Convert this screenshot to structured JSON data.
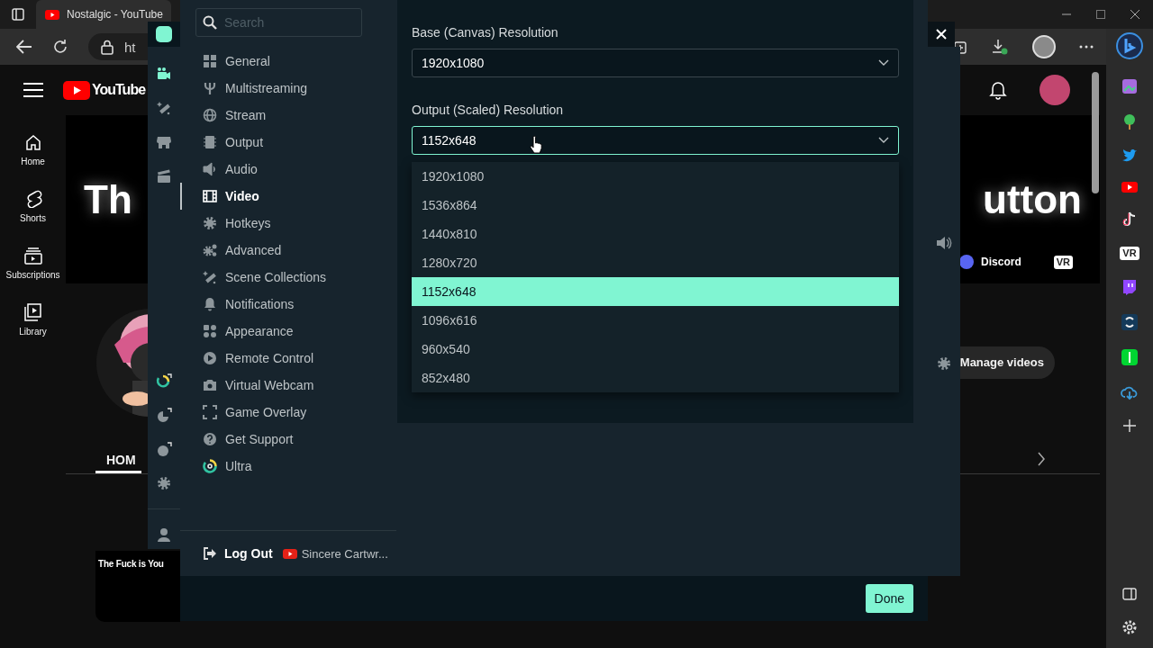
{
  "browser": {
    "tab_title": "Nostalgic - YouTube",
    "address": "ht"
  },
  "youtube": {
    "logo_text": "YouTube",
    "nav": [
      {
        "label": "Home"
      },
      {
        "label": "Shorts"
      },
      {
        "label": "Subscriptions"
      },
      {
        "label": "Library"
      }
    ],
    "banner": {
      "left_text": "Th",
      "right_text": "utton",
      "link": "Discord",
      "vr_badge": "VR"
    },
    "manage_button": "Manage videos",
    "tabs": [
      {
        "label": "HOM",
        "selected": true
      }
    ],
    "video_title": "The Fuck is You"
  },
  "edge_sidebar": {
    "vr_badge": "VR"
  },
  "app_rail": [
    {
      "selected": true
    },
    {
      "selected": false
    },
    {
      "selected": false
    },
    {
      "selected": false
    }
  ],
  "settings": {
    "search": {
      "placeholder": "Search"
    },
    "nav": [
      {
        "label": "General",
        "selected": false
      },
      {
        "label": "Multistreaming",
        "selected": false
      },
      {
        "label": "Stream",
        "selected": false
      },
      {
        "label": "Output",
        "selected": false
      },
      {
        "label": "Audio",
        "selected": false
      },
      {
        "label": "Video",
        "selected": true
      },
      {
        "label": "Hotkeys",
        "selected": false
      },
      {
        "label": "Advanced",
        "selected": false
      },
      {
        "label": "Scene Collections",
        "selected": false
      },
      {
        "label": "Notifications",
        "selected": false
      },
      {
        "label": "Appearance",
        "selected": false
      },
      {
        "label": "Remote Control",
        "selected": false
      },
      {
        "label": "Virtual Webcam",
        "selected": false
      },
      {
        "label": "Game Overlay",
        "selected": false
      },
      {
        "label": "Get Support",
        "selected": false
      },
      {
        "label": "Ultra",
        "selected": false
      }
    ],
    "account": {
      "logout": "Log Out",
      "user": "Sincere Cartwr..."
    },
    "fields": [
      {
        "label": "Base (Canvas) Resolution",
        "value": "1920x1080",
        "expanded": false
      },
      {
        "label": "Output (Scaled) Resolution",
        "value": "1152x648",
        "expanded": true,
        "options": [
          {
            "label": "1920x1080",
            "selected": false
          },
          {
            "label": "1536x864",
            "selected": false
          },
          {
            "label": "1440x810",
            "selected": false
          },
          {
            "label": "1280x720",
            "selected": false
          },
          {
            "label": "1152x648",
            "selected": true
          },
          {
            "label": "1096x616",
            "selected": false
          },
          {
            "label": "960x540",
            "selected": false
          },
          {
            "label": "852x480",
            "selected": false
          }
        ]
      }
    ],
    "done_button": "Done"
  }
}
